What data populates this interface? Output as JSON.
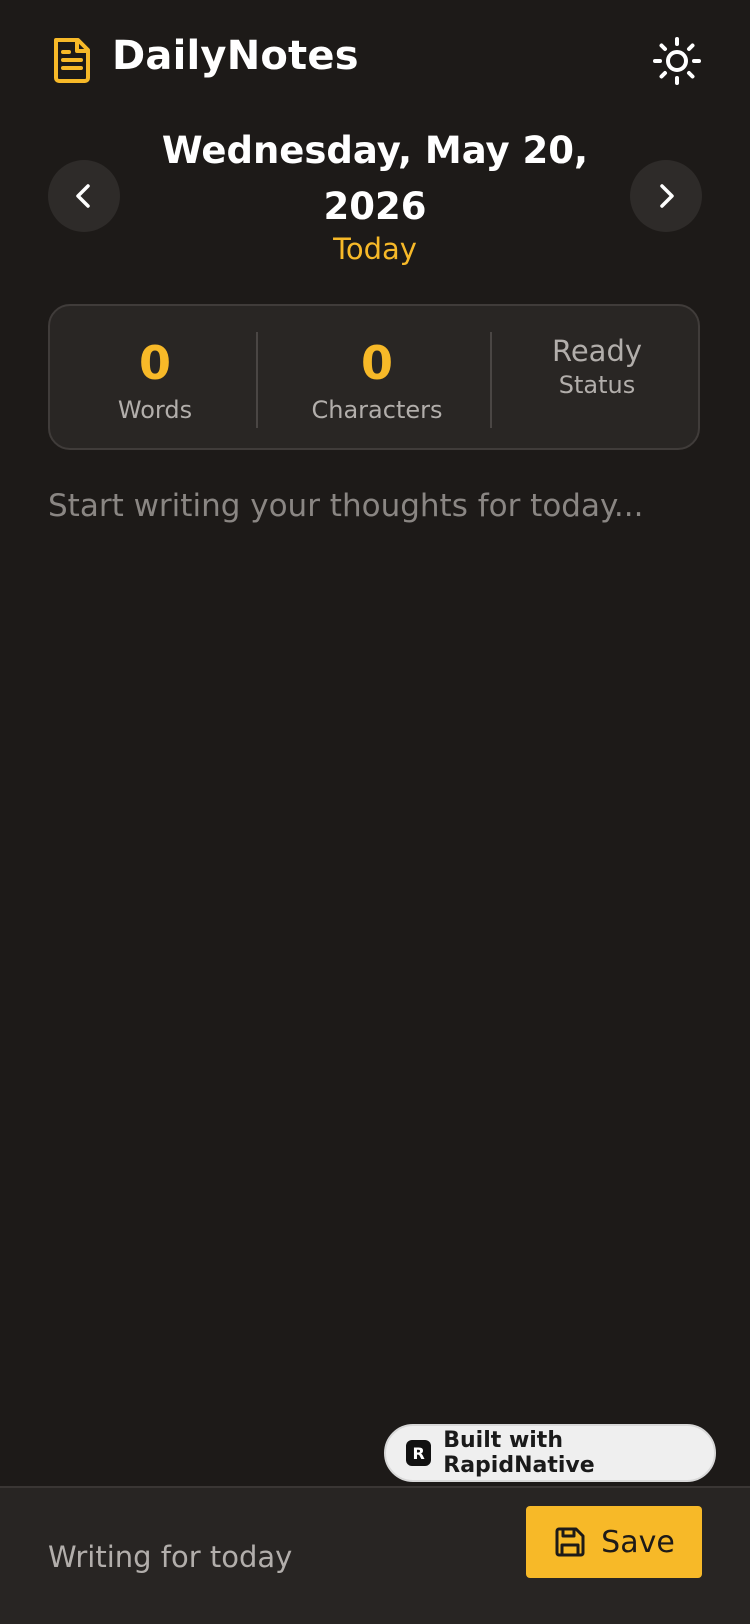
{
  "app": {
    "title": "DailyNotes"
  },
  "icons": {
    "logo": "file-text-icon",
    "theme": "sun-icon",
    "prev": "chevron-left-icon",
    "next": "chevron-right-icon",
    "save": "save-icon"
  },
  "date": {
    "label": "Wednesday, May 20, 2026",
    "relative": "Today"
  },
  "stats": {
    "words": {
      "value": "0",
      "label": "Words"
    },
    "characters": {
      "value": "0",
      "label": "Characters"
    },
    "status": {
      "value": "Ready",
      "label": "Status"
    }
  },
  "editor": {
    "placeholder": "Start writing your thoughts for today...",
    "value": ""
  },
  "badge": {
    "logo_letter": "R",
    "text": "Built with RapidNative"
  },
  "footer": {
    "status_text": "Writing for today",
    "save_label": "Save"
  },
  "colors": {
    "accent": "#f7b928",
    "background": "#1d1a18",
    "surface": "#292624"
  }
}
